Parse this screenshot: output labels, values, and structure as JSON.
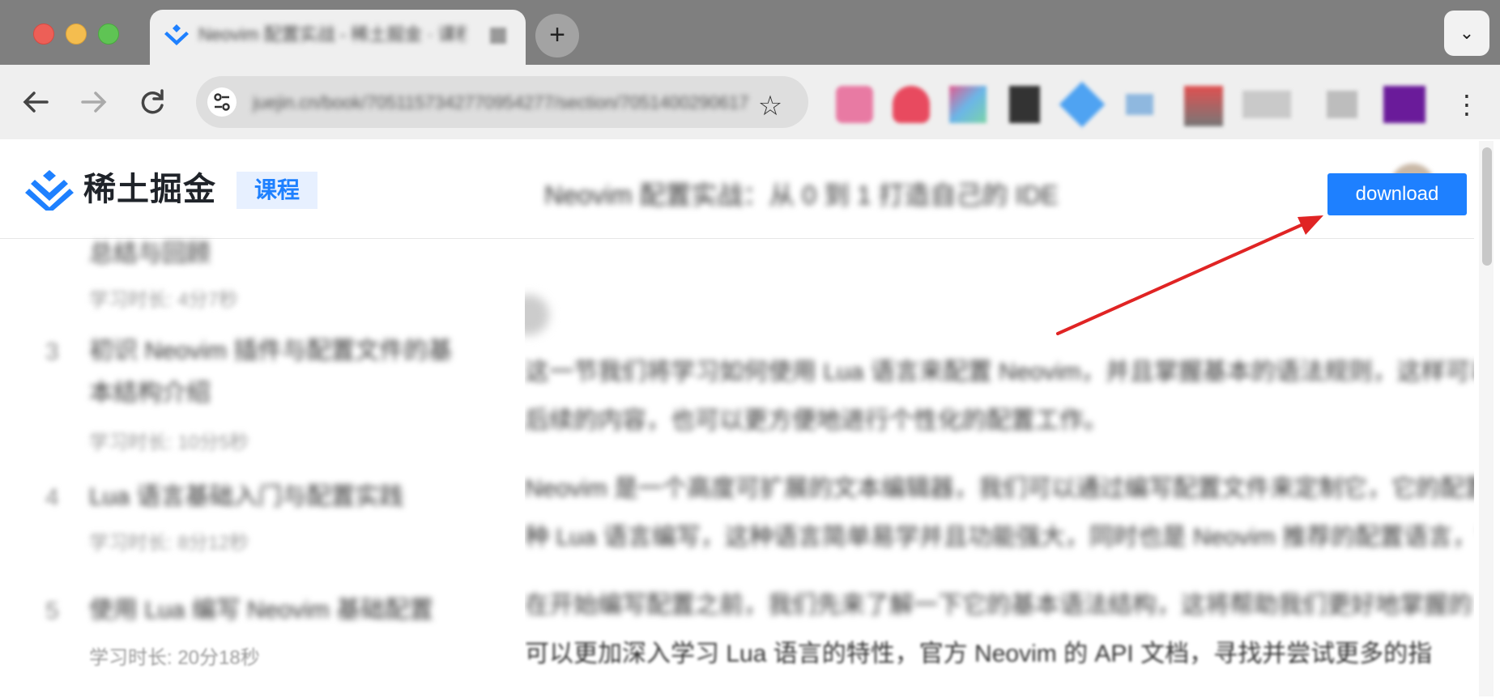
{
  "browser": {
    "tab_title": "Neovim 配置实战 - 稀土掘金 · 课程",
    "new_tab_label": "+",
    "tab_menu_icon": "chevron-down-icon",
    "address_url": "juejin.cn/book/7051157342770954277/section/7051400290617",
    "star_icon": "star-icon",
    "extensions": [
      "ext-pink",
      "ext-red",
      "ext-multi",
      "ext-dark",
      "ext-blue",
      "ext-lightblue",
      "ext-redgray",
      "ext-gray",
      "ext-grayline",
      "ext-purple"
    ],
    "menu_icon": "more-vertical-icon"
  },
  "site": {
    "logo_text": "稀土掘金",
    "course_label": "课程",
    "header_title": "Neovim 配置实战：从 0 到 1 打造自己的 IDE",
    "download_label": "download",
    "accent_color": "#1e80ff",
    "annotation_color": "#e02424"
  },
  "sidebar": {
    "items": [
      {
        "num": "",
        "title": "总结与回顾",
        "meta": "学习时长: 4分7秒"
      },
      {
        "num": "3",
        "title": "初识 Neovim 插件与配置文件的基本结构介绍",
        "meta": "学习时长: 10分5秒"
      },
      {
        "num": "4",
        "title": "Lua 语言基础入门与配置实践",
        "meta": "学习时长: 8分12秒"
      },
      {
        "num": "5",
        "title": "使用 Lua 编写 Neovim 基础配置",
        "meta": "学习时长: 20分18秒"
      }
    ]
  },
  "article": {
    "paragraphs": [
      "这一节我们将学习如何使用 Lua 语言来配置 Neovim，并且掌握基本的语法规则，这样可以帮助我们更好地理解了",
      "后续的内容，也可以更方便地进行个性化的配置工作。",
      "Neovim 是一个高度可扩展的文本编辑器，我们可以通过编写配置文件来定制它，它的配置文件可以使用一",
      "种 Lua 语言编写，这种语言简单易学并且功能强大，同时也是  Neovim  推荐的配置语言，它可以帮助我们使",
      "在开始编写配置之前，我们先来了解一下它的基本语法结构，这将帮助我们更好地掌握的",
      "可以更加深入学习 Lua 语言的特性，官方 Neovim 的 API 文档，寻找并尝试更多的指"
    ],
    "highlight_word": "Neovim"
  }
}
